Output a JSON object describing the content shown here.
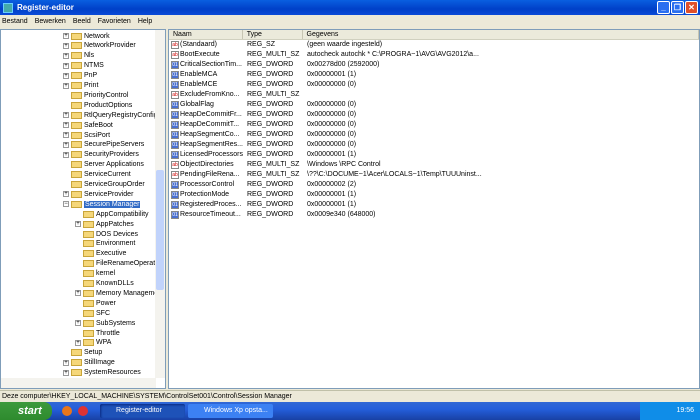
{
  "window": {
    "title": "Register-editor"
  },
  "menu": [
    "Bestand",
    "Bewerken",
    "Beeld",
    "Favorieten",
    "Help"
  ],
  "tree": [
    {
      "label": "Network",
      "level": 1,
      "exp": true
    },
    {
      "label": "NetworkProvider",
      "level": 1,
      "exp": true
    },
    {
      "label": "Nls",
      "level": 1,
      "exp": true
    },
    {
      "label": "NTMS",
      "level": 1,
      "exp": true
    },
    {
      "label": "PnP",
      "level": 1,
      "exp": true
    },
    {
      "label": "Print",
      "level": 1,
      "exp": true
    },
    {
      "label": "PriorityControl",
      "level": 1,
      "exp": false
    },
    {
      "label": "ProductOptions",
      "level": 1,
      "exp": false
    },
    {
      "label": "RtlQueryRegistryConfig",
      "level": 1,
      "exp": true
    },
    {
      "label": "SafeBoot",
      "level": 1,
      "exp": true
    },
    {
      "label": "ScsiPort",
      "level": 1,
      "exp": true
    },
    {
      "label": "SecurePipeServers",
      "level": 1,
      "exp": true
    },
    {
      "label": "SecurityProviders",
      "level": 1,
      "exp": true
    },
    {
      "label": "Server Applications",
      "level": 1,
      "exp": false
    },
    {
      "label": "ServiceCurrent",
      "level": 1,
      "exp": false
    },
    {
      "label": "ServiceGroupOrder",
      "level": 1,
      "exp": false
    },
    {
      "label": "ServiceProvider",
      "level": 1,
      "exp": true
    },
    {
      "label": "Session Manager",
      "level": 1,
      "exp": "open",
      "selected": true
    },
    {
      "label": "AppCompatibility",
      "level": 2,
      "exp": false
    },
    {
      "label": "AppPatches",
      "level": 2,
      "exp": true
    },
    {
      "label": "DOS Devices",
      "level": 2,
      "exp": false
    },
    {
      "label": "Environment",
      "level": 2,
      "exp": false
    },
    {
      "label": "Executive",
      "level": 2,
      "exp": false
    },
    {
      "label": "FileRenameOperatio",
      "level": 2,
      "exp": false
    },
    {
      "label": "kernel",
      "level": 2,
      "exp": false
    },
    {
      "label": "KnownDLLs",
      "level": 2,
      "exp": false
    },
    {
      "label": "Memory Managemer",
      "level": 2,
      "exp": true
    },
    {
      "label": "Power",
      "level": 2,
      "exp": false
    },
    {
      "label": "SFC",
      "level": 2,
      "exp": false
    },
    {
      "label": "SubSystems",
      "level": 2,
      "exp": true
    },
    {
      "label": "Throttle",
      "level": 2,
      "exp": false
    },
    {
      "label": "WPA",
      "level": 2,
      "exp": true
    },
    {
      "label": "Setup",
      "level": 1,
      "exp": false
    },
    {
      "label": "StillImage",
      "level": 1,
      "exp": true
    },
    {
      "label": "SystemResources",
      "level": 1,
      "exp": true
    }
  ],
  "columns": [
    "Naam",
    "Type",
    "Gegevens"
  ],
  "values": [
    {
      "name": "(Standaard)",
      "type": "REG_SZ",
      "data": "(geen waarde ingesteld)",
      "icon": "sz"
    },
    {
      "name": "BootExecute",
      "type": "REG_MULTI_SZ",
      "data": "autocheck autochk * C:\\PROGRA~1\\AVG\\AVG2012\\a...",
      "icon": "sz"
    },
    {
      "name": "CriticalSectionTim...",
      "type": "REG_DWORD",
      "data": "0x00278d00 (2592000)",
      "icon": "bin"
    },
    {
      "name": "EnableMCA",
      "type": "REG_DWORD",
      "data": "0x00000001 (1)",
      "icon": "bin"
    },
    {
      "name": "EnableMCE",
      "type": "REG_DWORD",
      "data": "0x00000000 (0)",
      "icon": "bin"
    },
    {
      "name": "ExcludeFromKno...",
      "type": "REG_MULTI_SZ",
      "data": "",
      "icon": "sz"
    },
    {
      "name": "GlobalFlag",
      "type": "REG_DWORD",
      "data": "0x00000000 (0)",
      "icon": "bin"
    },
    {
      "name": "HeapDeCommitFr...",
      "type": "REG_DWORD",
      "data": "0x00000000 (0)",
      "icon": "bin"
    },
    {
      "name": "HeapDeCommitT...",
      "type": "REG_DWORD",
      "data": "0x00000000 (0)",
      "icon": "bin"
    },
    {
      "name": "HeapSegmentCo...",
      "type": "REG_DWORD",
      "data": "0x00000000 (0)",
      "icon": "bin"
    },
    {
      "name": "HeapSegmentRes...",
      "type": "REG_DWORD",
      "data": "0x00000000 (0)",
      "icon": "bin"
    },
    {
      "name": "LicensedProcessors",
      "type": "REG_DWORD",
      "data": "0x00000001 (1)",
      "icon": "bin"
    },
    {
      "name": "ObjectDirectories",
      "type": "REG_MULTI_SZ",
      "data": "\\Windows \\RPC Control",
      "icon": "sz"
    },
    {
      "name": "PendingFileRena...",
      "type": "REG_MULTI_SZ",
      "data": "\\??\\C:\\DOCUME~1\\Acer\\LOCALS~1\\Temp\\TUUUninst...",
      "icon": "sz"
    },
    {
      "name": "ProcessorControl",
      "type": "REG_DWORD",
      "data": "0x00000002 (2)",
      "icon": "bin"
    },
    {
      "name": "ProtectionMode",
      "type": "REG_DWORD",
      "data": "0x00000001 (1)",
      "icon": "bin"
    },
    {
      "name": "RegisteredProces...",
      "type": "REG_DWORD",
      "data": "0x00000001 (1)",
      "icon": "bin"
    },
    {
      "name": "ResourceTimeout...",
      "type": "REG_DWORD",
      "data": "0x0009e340 (648000)",
      "icon": "bin"
    }
  ],
  "status": "Deze computer\\HKEY_LOCAL_MACHINE\\SYSTEM\\ControlSet001\\Control\\Session Manager",
  "taskbar": {
    "start": "start",
    "tasks": [
      "Register-editor",
      "Windows Xp opsta..."
    ],
    "clock": "19:56"
  }
}
